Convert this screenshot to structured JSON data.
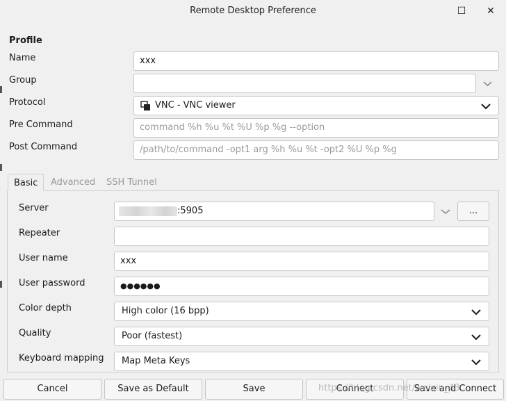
{
  "window": {
    "title": "Remote Desktop Preference",
    "maximize_glyph": "☐",
    "close_glyph": "✕"
  },
  "profile": {
    "heading": "Profile",
    "name_label": "Name",
    "name_value": "xxx",
    "group_label": "Group",
    "group_value": "",
    "protocol_label": "Protocol",
    "protocol_value": "VNC - VNC viewer",
    "pre_command_label": "Pre Command",
    "pre_command_placeholder": "command %h %u %t %U %p %g --option",
    "post_command_label": "Post Command",
    "post_command_placeholder": "/path/to/command -opt1 arg %h %u %t -opt2 %U %p %g"
  },
  "tabs": {
    "basic": "Basic",
    "advanced": "Advanced",
    "ssh_tunnel": "SSH Tunnel"
  },
  "basic": {
    "server_label": "Server",
    "server_value_suffix": ":5905",
    "browse_label": "...",
    "repeater_label": "Repeater",
    "repeater_value": "",
    "username_label": "User name",
    "username_value": "xxx",
    "password_label": "User password",
    "password_value": "●●●●●●",
    "color_depth_label": "Color depth",
    "color_depth_value": "High color (16 bpp)",
    "quality_label": "Quality",
    "quality_value": "Poor (fastest)",
    "keyboard_mapping_label": "Keyboard mapping",
    "keyboard_mapping_value": "Map Meta Keys"
  },
  "buttons": {
    "cancel": "Cancel",
    "save_default": "Save as Default",
    "save": "Save",
    "connect": "Connect",
    "save_connect": "Save and Connect"
  },
  "watermark": "https://blog.csdn.net/weixin_43...",
  "icons": {
    "protocol": "vnc-icon",
    "chevron": "chevron-down-icon",
    "maximize": "maximize-icon",
    "close": "close-icon"
  }
}
